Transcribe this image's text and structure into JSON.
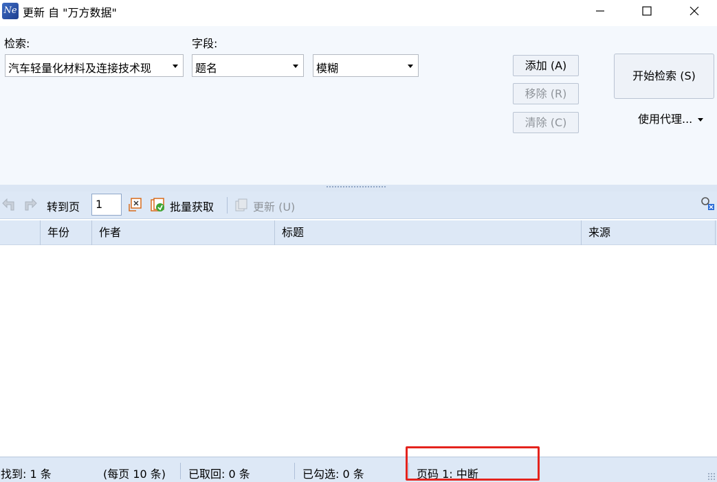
{
  "window": {
    "title": "更新 自 \"万方数据\"",
    "app_icon_text": "Ne"
  },
  "search": {
    "query_label": "检索:",
    "query_value": "汽车轻量化材料及连接技术现",
    "field_label": "字段:",
    "field_value": "题名",
    "match_value": "模糊",
    "add_label": "添加 (A)",
    "remove_label": "移除 (R)",
    "clear_label": "清除 (C)",
    "start_label": "开始检索 (S)",
    "proxy_label": "使用代理..."
  },
  "toolbar": {
    "goto_label": "转到页",
    "page_value": "1",
    "batch_label": "批量获取",
    "update_label": "更新 (U)"
  },
  "table": {
    "columns": [
      "年份",
      "作者",
      "标题",
      "来源"
    ]
  },
  "status": {
    "found": "找到: 1 条",
    "per_page": "(每页 10 条)",
    "retrieved": "已取回: 0 条",
    "checked": "已勾选: 0 条",
    "page_state": "页码 1: 中断"
  },
  "colors": {
    "panel_bg": "#f4f8fd",
    "toolbar_bg": "#dde8f6",
    "highlight": "#e4231d"
  },
  "icons": [
    "app-icon",
    "minimize-icon",
    "maximize-icon",
    "close-icon",
    "prev-page-icon",
    "next-page-icon",
    "goto-page-icon",
    "batch-fetch-icon",
    "update-icon",
    "clear-search-icon"
  ]
}
